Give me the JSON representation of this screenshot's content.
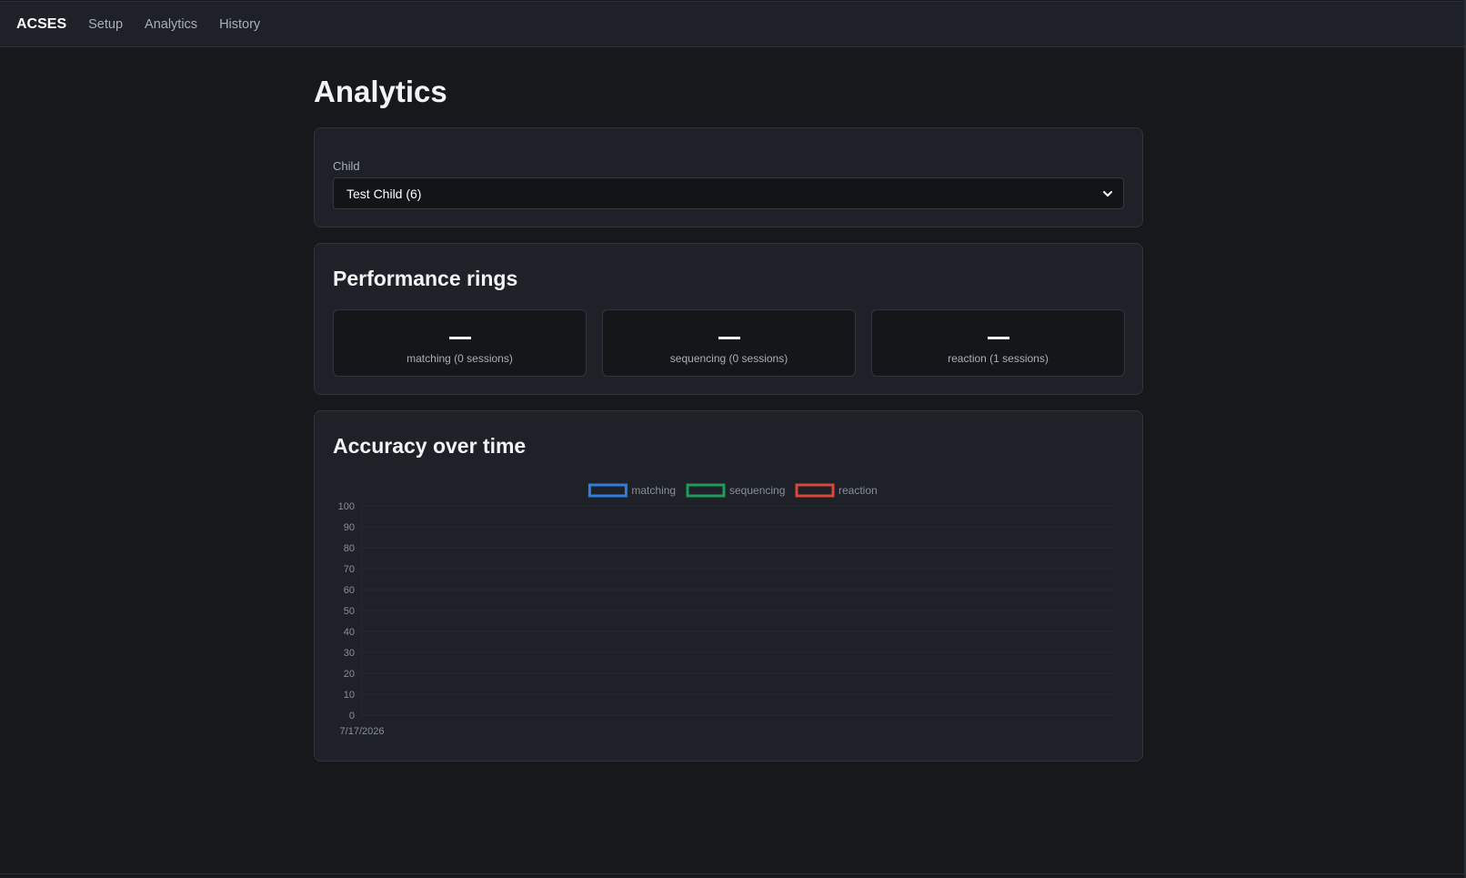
{
  "nav": {
    "brand": "ACSES",
    "links": [
      "Setup",
      "Analytics",
      "History"
    ]
  },
  "page": {
    "title": "Analytics"
  },
  "child_selector": {
    "label": "Child",
    "selected": "Test Child (6)"
  },
  "performance_rings": {
    "title": "Performance rings",
    "rings": [
      {
        "value": "—",
        "label": "matching (0 sessions)"
      },
      {
        "value": "—",
        "label": "sequencing (0 sessions)"
      },
      {
        "value": "—",
        "label": "reaction (1 sessions)"
      }
    ]
  },
  "accuracy": {
    "title": "Accuracy over time"
  },
  "chart_data": {
    "type": "line",
    "x": [
      "7/17/2026"
    ],
    "series": [
      {
        "name": "matching",
        "color": "#2f7de1",
        "values": []
      },
      {
        "name": "sequencing",
        "color": "#1e9c5a",
        "values": []
      },
      {
        "name": "reaction",
        "color": "#d9463b",
        "values": []
      }
    ],
    "ylim": [
      0,
      100
    ],
    "yticks": [
      0,
      10,
      20,
      30,
      40,
      50,
      60,
      70,
      80,
      90,
      100
    ],
    "legend": "top-center",
    "grid": true
  },
  "colors": {
    "background": "#16181c",
    "card": "#1e2127",
    "border": "#30343c"
  }
}
